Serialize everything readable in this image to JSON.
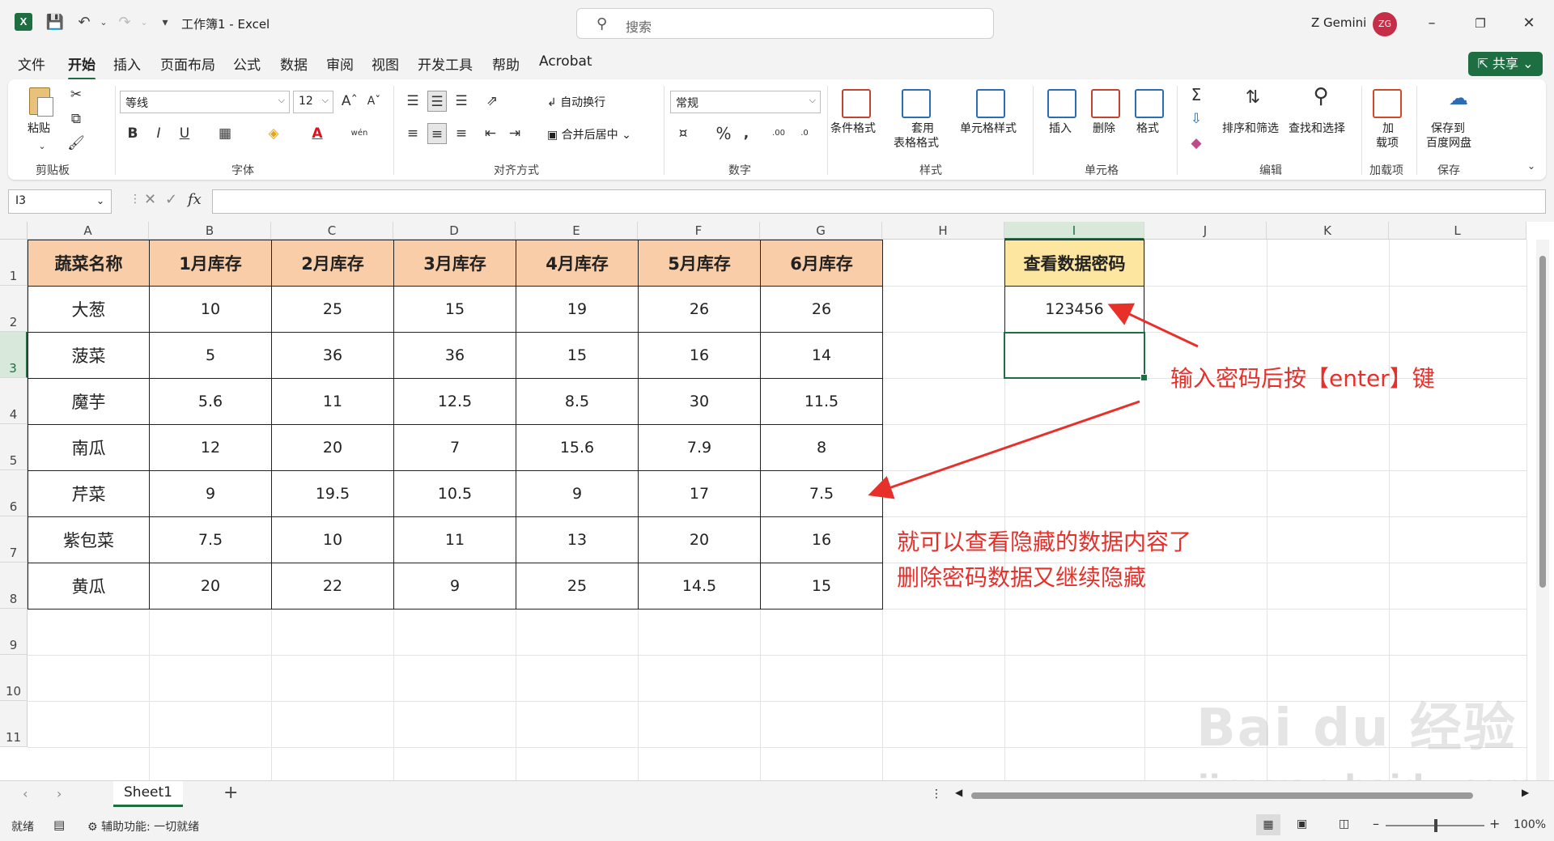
{
  "app": {
    "title": "工作簿1  -  Excel",
    "search_placeholder": "搜索",
    "user_name": "Z Gemini",
    "user_initials": "ZG",
    "share_label": "共享",
    "accent_color": "#1d6f42"
  },
  "menu": {
    "tabs": [
      "文件",
      "开始",
      "插入",
      "页面布局",
      "公式",
      "数据",
      "审阅",
      "视图",
      "开发工具",
      "帮助",
      "Acrobat"
    ],
    "active": "开始"
  },
  "ribbon": {
    "clipboard": {
      "paste": "粘贴",
      "group": "剪贴板"
    },
    "font": {
      "name": "等线",
      "size": "12",
      "group": "字体"
    },
    "alignment": {
      "wrap": "自动换行",
      "merge": "合并后居中",
      "group": "对齐方式"
    },
    "number": {
      "format": "常规",
      "group": "数字"
    },
    "styles": {
      "conditional": "条件格式",
      "table_1": "套用",
      "table_2": "表格格式",
      "cell_styles": "单元格样式",
      "group": "样式"
    },
    "cells": {
      "insert": "插入",
      "delete": "删除",
      "format": "格式",
      "group": "单元格"
    },
    "editing": {
      "sort": "排序和筛选",
      "find": "查找和选择",
      "group": "编辑"
    },
    "addins": {
      "label_1": "加",
      "label_2": "载项",
      "group": "加载项"
    },
    "save": {
      "label_1": "保存到",
      "label_2": "百度网盘",
      "group": "保存"
    }
  },
  "formula_bar": {
    "name_box": "I3",
    "formula": ""
  },
  "sheet": {
    "columns": [
      "A",
      "B",
      "C",
      "D",
      "E",
      "F",
      "G",
      "H",
      "I",
      "J",
      "K",
      "L"
    ],
    "rows": [
      "1",
      "2",
      "3",
      "4",
      "5",
      "6",
      "7",
      "8",
      "9",
      "10",
      "11"
    ],
    "table_header": [
      "蔬菜名称",
      "1月库存",
      "2月库存",
      "3月库存",
      "4月库存",
      "5月库存",
      "6月库存"
    ],
    "table_rows": [
      [
        "大葱",
        "10",
        "25",
        "15",
        "19",
        "26",
        "26"
      ],
      [
        "菠菜",
        "5",
        "36",
        "36",
        "15",
        "16",
        "14"
      ],
      [
        "魔芋",
        "5.6",
        "11",
        "12.5",
        "8.5",
        "30",
        "11.5"
      ],
      [
        "南瓜",
        "12",
        "20",
        "7",
        "15.6",
        "7.9",
        "8"
      ],
      [
        "芹菜",
        "9",
        "19.5",
        "10.5",
        "9",
        "17",
        "7.5"
      ],
      [
        "紫包菜",
        "7.5",
        "10",
        "11",
        "13",
        "20",
        "16"
      ],
      [
        "黄瓜",
        "20",
        "22",
        "9",
        "25",
        "14.5",
        "15"
      ]
    ],
    "password_header": "查看数据密码",
    "password_value": "123456",
    "header_fill": "#f9cda8",
    "password_fill": "#fde7a0"
  },
  "annotations": {
    "note_1": "输入密码后按【enter】键",
    "note_2_line1": "就可以查看隐藏的数据内容了",
    "note_2_line2": "删除密码数据又继续隐藏",
    "color": "#e8302b"
  },
  "sheet_tabs": {
    "active": "Sheet1",
    "add": "+"
  },
  "status": {
    "ready": "就绪",
    "accessibility": "辅助功能: 一切就绪",
    "zoom": "100%"
  },
  "watermark": {
    "brand": "Bai du 经验",
    "url": "jingyan.baidu.com"
  }
}
